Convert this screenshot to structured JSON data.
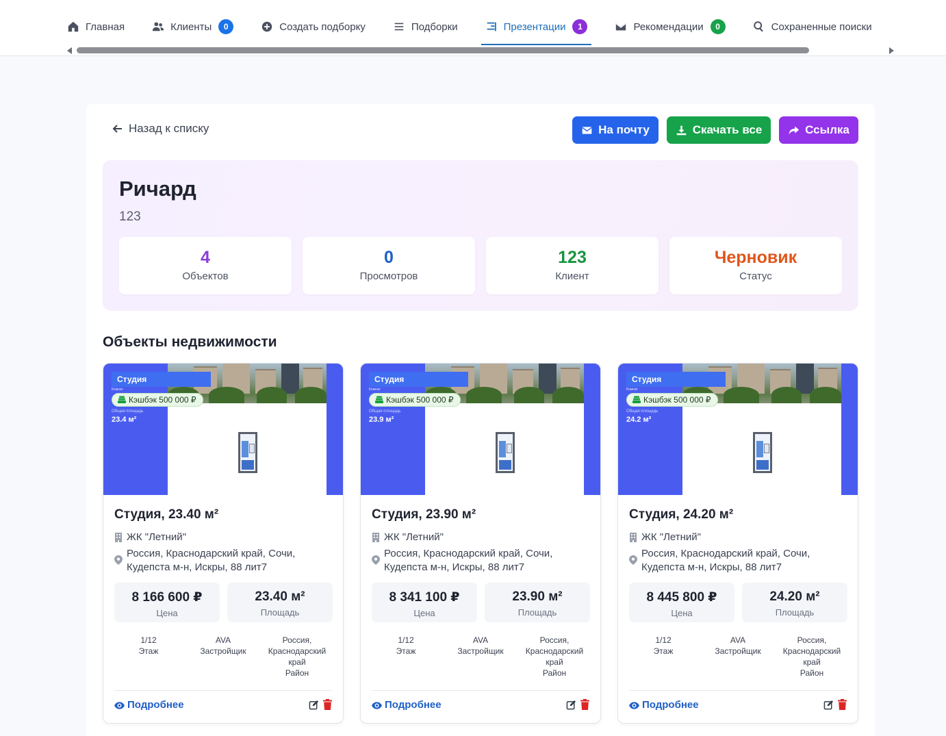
{
  "nav": {
    "tabs": [
      {
        "label": "Главная",
        "icon": "home-icon"
      },
      {
        "label": "Клиенты",
        "icon": "users-icon",
        "badge": "0",
        "badge_color": "#1a73e8"
      },
      {
        "label": "Создать подборку",
        "icon": "plus-circle-icon"
      },
      {
        "label": "Подборки",
        "icon": "list-icon"
      },
      {
        "label": "Презентации",
        "icon": "presentation-icon",
        "badge": "1",
        "badge_color": "#8b2fd8",
        "active": true
      },
      {
        "label": "Рекомендации",
        "icon": "envelope-icon",
        "badge": "0",
        "badge_color": "#16a34a"
      },
      {
        "label": "Сохраненные поиски",
        "icon": "search-icon"
      }
    ]
  },
  "toolbar": {
    "back_label": "Назад к списку",
    "email_label": "На почту",
    "download_label": "Скачать все",
    "link_label": "Ссылка",
    "colors": {
      "email": "#2563eb",
      "download": "#16a34a",
      "link": "#9333ea"
    }
  },
  "presentation": {
    "title": "Ричард",
    "subtitle": "123",
    "stats": [
      {
        "value": "4",
        "label": "Объектов",
        "color": "#8b3fd6"
      },
      {
        "value": "0",
        "label": "Просмотров",
        "color": "#1d5fc9"
      },
      {
        "value": "123",
        "label": "Клиент",
        "color": "#18943e"
      },
      {
        "value": "Черновик",
        "label": "Статус",
        "color": "#e0561b"
      }
    ]
  },
  "section_title": "Объекты недвижимости",
  "cards": [
    {
      "image": {
        "type_tag": "Студия",
        "tag_sub": "Комнат",
        "cashback": "Кэшбэк 500 000 ₽",
        "area_label": "Общая площадь",
        "area_value": "23.4 м²"
      },
      "title": "Студия, 23.40 м²",
      "complex": "ЖК \"Летний\"",
      "address": "Россия, Краснодарский край, Сочи, Кудепста м-н, Искры, 88 лит7",
      "price": "8 166 600 ₽",
      "price_label": "Цена",
      "area": "23.40 м²",
      "area_label": "Площадь",
      "floor": "1/12",
      "floor_label": "Этаж",
      "developer": "AVA",
      "developer_label": "Застройщик",
      "district": "Россия, Краснодарский край",
      "district_label": "Район",
      "more_label": "Подробнее"
    },
    {
      "image": {
        "type_tag": "Студия",
        "tag_sub": "Комнат",
        "cashback": "Кэшбэк 500 000 ₽",
        "area_label": "Общая площадь",
        "area_value": "23.9 м²"
      },
      "title": "Студия, 23.90 м²",
      "complex": "ЖК \"Летний\"",
      "address": "Россия, Краснодарский край, Сочи, Кудепста м-н, Искры, 88 лит7",
      "price": "8 341 100 ₽",
      "price_label": "Цена",
      "area": "23.90 м²",
      "area_label": "Площадь",
      "floor": "1/12",
      "floor_label": "Этаж",
      "developer": "AVA",
      "developer_label": "Застройщик",
      "district": "Россия, Краснодарский край",
      "district_label": "Район",
      "more_label": "Подробнее"
    },
    {
      "image": {
        "type_tag": "Студия",
        "tag_sub": "Комнат",
        "cashback": "Кэшбэк 500 000 ₽",
        "area_label": "Общая площадь",
        "area_value": "24.2 м²"
      },
      "title": "Студия, 24.20 м²",
      "complex": "ЖК \"Летний\"",
      "address": "Россия, Краснодарский край, Сочи, Кудепста м-н, Искры, 88 лит7",
      "price": "8 445 800 ₽",
      "price_label": "Цена",
      "area": "24.20 м²",
      "area_label": "Площадь",
      "floor": "1/12",
      "floor_label": "Этаж",
      "developer": "AVA",
      "developer_label": "Застройщик",
      "district": "Россия, Краснодарский край",
      "district_label": "Район",
      "more_label": "Подробнее"
    }
  ]
}
